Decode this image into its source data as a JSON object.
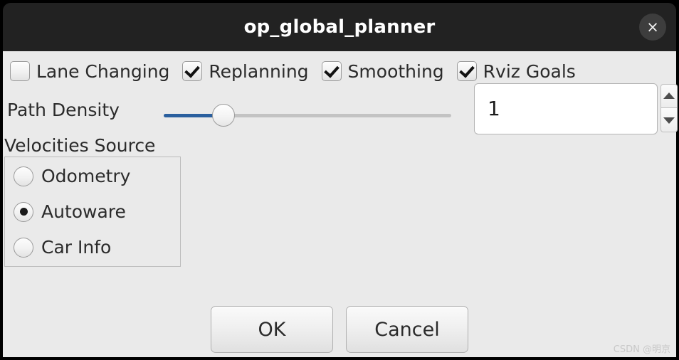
{
  "window": {
    "title": "op_global_planner",
    "close_icon": "×",
    "background": "#eaeaea",
    "titlebar_background": "#222222"
  },
  "checkboxes": [
    {
      "label": "Lane Changing",
      "checked": false
    },
    {
      "label": "Replanning",
      "checked": true
    },
    {
      "label": "Smoothing",
      "checked": true
    },
    {
      "label": "Rviz Goals",
      "checked": true
    }
  ],
  "path_density": {
    "label": "Path Density",
    "value": "1",
    "slider_fill_color": "#2a5f9e",
    "slider_percent": 20,
    "spin_up_icon": "triangle-up",
    "spin_down_icon": "triangle-down"
  },
  "velocities_source": {
    "title": "Velocities Source",
    "options": [
      {
        "label": "Odometry",
        "selected": false
      },
      {
        "label": "Autoware",
        "selected": true
      },
      {
        "label": "Car Info",
        "selected": false
      }
    ]
  },
  "buttons": {
    "ok": "OK",
    "cancel": "Cancel"
  },
  "watermark": "CSDN @明京"
}
